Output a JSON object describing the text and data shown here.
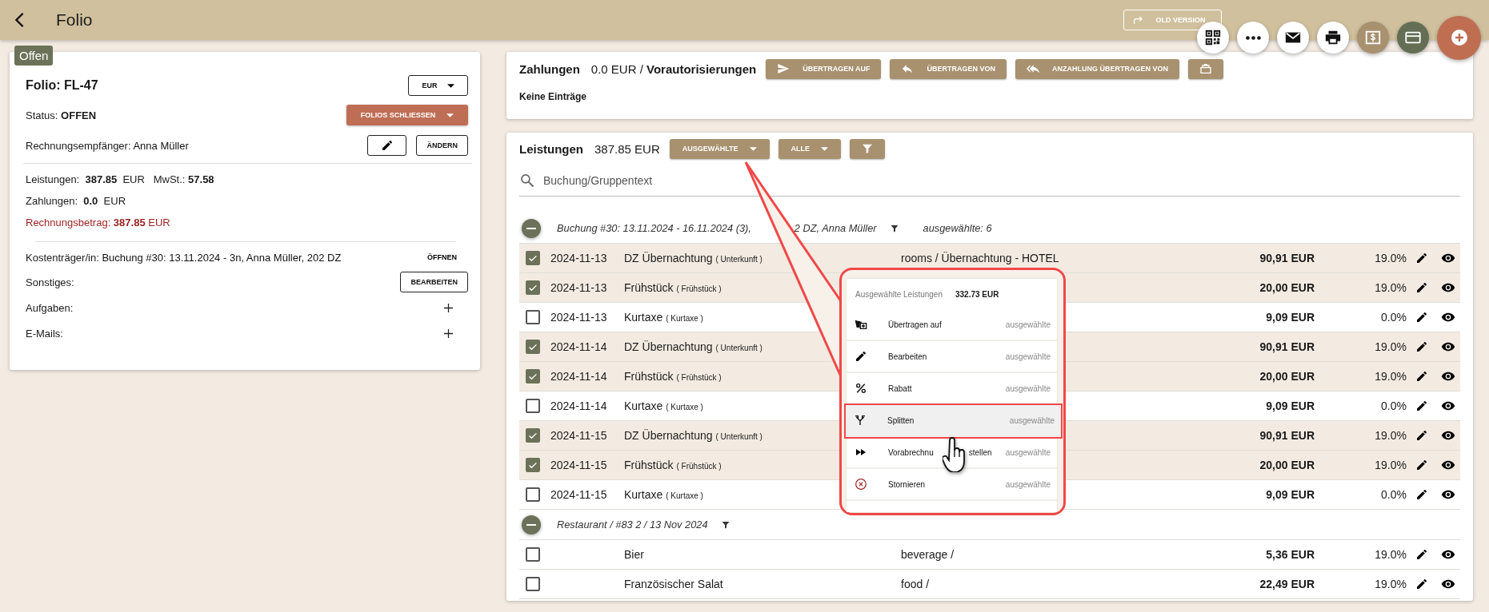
{
  "header": {
    "title": "Folio",
    "old_version": "OLD VERSION"
  },
  "folio": {
    "badge": "Offen",
    "title": "Folio: FL-47",
    "currency": "EUR",
    "status": "Status: **OFFEN**",
    "close_button": "FOLIOS SCHLIESSEN",
    "recipient_label": "Rechnungsempfänger:",
    "recipient": "Anna Müller",
    "change_button": "ÄNDERN",
    "services": "Leistungen:  **387.85**  EUR   MwSt.: **57.58**",
    "payments": "Zahlungen:  **0.0**  EUR",
    "invoice": "Rechnungsbetrag: **387.85** EUR",
    "cost_label": "Kostenträger/in:",
    "cost_value": "Buchung #30: 13.11.2024 - 3n, Anna Müller, 202 DZ",
    "open_link": "ÖFFNEN",
    "misc_label": "Sonstiges:",
    "edit_button": "BEARBEITEN",
    "tasks_label": "Aufgaben:",
    "emails_label": "E-Mails:"
  },
  "payments": {
    "title": "Zahlungen",
    "summary": "0.0 EUR / **Vorautorisierungen**",
    "empty": "Keine Einträge",
    "buttons": [
      {
        "kind": "send",
        "label": "ÜBERTRAGEN AUF"
      },
      {
        "kind": "reply",
        "label": "ÜBERTRAGEN VON"
      },
      {
        "kind": "reply-all",
        "label": "ANZAHLUNG ÜBERTRAGEN VON"
      },
      {
        "kind": "register"
      }
    ]
  },
  "services": {
    "title": "Leistungen",
    "total": "387.85 EUR",
    "selected_button": "AUSGEWÄHLTE",
    "all_button": "ALLE",
    "search": {
      "placeholder": "Buchung/Gruppentext"
    },
    "groups": [
      {
        "title": "Buchung #30: 13.11.2024 - 16.11.2024 (3),",
        "title_continued": "2 DZ, Anna Müller",
        "count": "ausgewählte: 6",
        "rows": [
          {
            "checked": true,
            "date": "2024-11-13",
            "name": "DZ Übernachtung",
            "category": "( Unterkunft )",
            "account": "rooms / Übernachtung - HOTEL",
            "amount": "90,91 EUR",
            "vat": "19.0%"
          },
          {
            "checked": true,
            "date": "2024-11-13",
            "name": "Frühstück",
            "category": "( Frühstück )",
            "amount": "20,00 EUR",
            "vat": "19.0%"
          },
          {
            "checked": false,
            "date": "2024-11-13",
            "name": "Kurtaxe",
            "category": "( Kurtaxe )",
            "amount": "9,09 EUR",
            "vat": "0.0%"
          },
          {
            "checked": true,
            "date": "2024-11-14",
            "name": "DZ Übernachtung",
            "category": "( Unterkunft )",
            "amount": "90,91 EUR",
            "vat": "19.0%"
          },
          {
            "checked": true,
            "date": "2024-11-14",
            "name": "Frühstück",
            "category": "( Frühstück )",
            "amount": "20,00 EUR",
            "vat": "19.0%"
          },
          {
            "checked": false,
            "date": "2024-11-14",
            "name": "Kurtaxe",
            "category": "( Kurtaxe )",
            "amount": "9,09 EUR",
            "vat": "0.0%"
          },
          {
            "checked": true,
            "date": "2024-11-15",
            "name": "DZ Übernachtung",
            "category": "( Unterkunft )",
            "amount": "90,91 EUR",
            "vat": "19.0%"
          },
          {
            "checked": true,
            "date": "2024-11-15",
            "name": "Frühstück",
            "category": "( Frühstück )",
            "amount": "20,00 EUR",
            "vat": "19.0%"
          },
          {
            "checked": false,
            "date": "2024-11-15",
            "name": "Kurtaxe",
            "category": "( Kurtaxe )",
            "amount": "9,09 EUR",
            "vat": "0.0%"
          }
        ]
      },
      {
        "title": "Restaurant / #83 2 / 13 Nov 2024",
        "rows": [
          {
            "checked": false,
            "name": "Bier",
            "account": "beverage /",
            "amount": "5,36 EUR",
            "vat": "19.0%"
          },
          {
            "checked": false,
            "name": "Französischer Salat",
            "account": "food /",
            "amount": "22,49 EUR",
            "vat": "19.0%"
          }
        ]
      }
    ]
  },
  "popup": {
    "title": "Ausgewählte Leistungen",
    "total": "332.73 EUR",
    "items": [
      {
        "kind": "transfer",
        "label": "Übertragen auf",
        "scope": "ausgewählte",
        "selected": false
      },
      {
        "kind": "edit",
        "label": "Bearbeiten",
        "scope": "ausgewählte",
        "selected": false
      },
      {
        "kind": "percent",
        "label": "Rabatt",
        "scope": "ausgewählte",
        "selected": false
      },
      {
        "kind": "split",
        "label": "Splitten",
        "scope": "ausgewählte",
        "selected": true
      },
      {
        "kind": "forward",
        "label": "Vorabrechnu",
        "label_continued": "stellen",
        "scope": "ausgewählte",
        "selected": false
      },
      {
        "kind": "cancel",
        "label": "Stornieren",
        "scope": "ausgewählte",
        "selected": false
      }
    ]
  }
}
